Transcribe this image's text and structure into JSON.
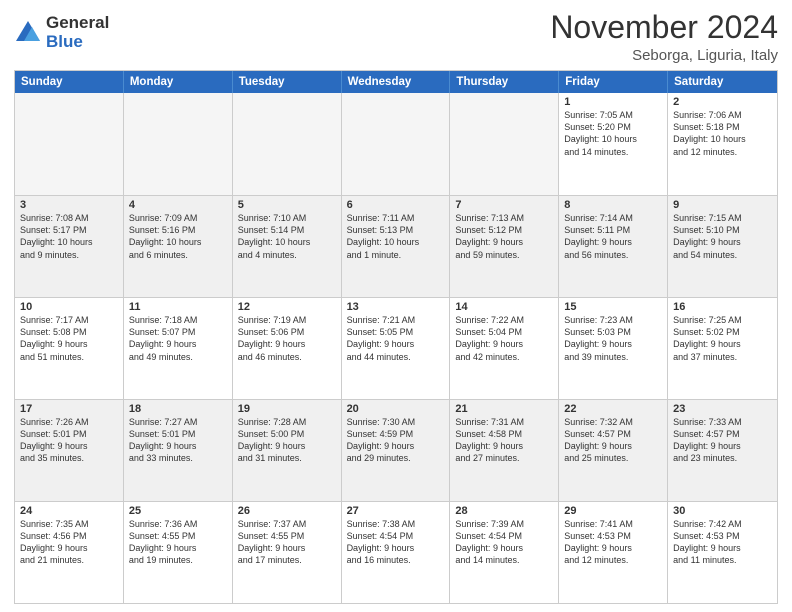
{
  "logo": {
    "general": "General",
    "blue": "Blue"
  },
  "header": {
    "month": "November 2024",
    "location": "Seborga, Liguria, Italy"
  },
  "weekdays": [
    "Sunday",
    "Monday",
    "Tuesday",
    "Wednesday",
    "Thursday",
    "Friday",
    "Saturday"
  ],
  "rows": [
    [
      {
        "day": "",
        "info": ""
      },
      {
        "day": "",
        "info": ""
      },
      {
        "day": "",
        "info": ""
      },
      {
        "day": "",
        "info": ""
      },
      {
        "day": "",
        "info": ""
      },
      {
        "day": "1",
        "info": "Sunrise: 7:05 AM\nSunset: 5:20 PM\nDaylight: 10 hours\nand 14 minutes."
      },
      {
        "day": "2",
        "info": "Sunrise: 7:06 AM\nSunset: 5:18 PM\nDaylight: 10 hours\nand 12 minutes."
      }
    ],
    [
      {
        "day": "3",
        "info": "Sunrise: 7:08 AM\nSunset: 5:17 PM\nDaylight: 10 hours\nand 9 minutes."
      },
      {
        "day": "4",
        "info": "Sunrise: 7:09 AM\nSunset: 5:16 PM\nDaylight: 10 hours\nand 6 minutes."
      },
      {
        "day": "5",
        "info": "Sunrise: 7:10 AM\nSunset: 5:14 PM\nDaylight: 10 hours\nand 4 minutes."
      },
      {
        "day": "6",
        "info": "Sunrise: 7:11 AM\nSunset: 5:13 PM\nDaylight: 10 hours\nand 1 minute."
      },
      {
        "day": "7",
        "info": "Sunrise: 7:13 AM\nSunset: 5:12 PM\nDaylight: 9 hours\nand 59 minutes."
      },
      {
        "day": "8",
        "info": "Sunrise: 7:14 AM\nSunset: 5:11 PM\nDaylight: 9 hours\nand 56 minutes."
      },
      {
        "day": "9",
        "info": "Sunrise: 7:15 AM\nSunset: 5:10 PM\nDaylight: 9 hours\nand 54 minutes."
      }
    ],
    [
      {
        "day": "10",
        "info": "Sunrise: 7:17 AM\nSunset: 5:08 PM\nDaylight: 9 hours\nand 51 minutes."
      },
      {
        "day": "11",
        "info": "Sunrise: 7:18 AM\nSunset: 5:07 PM\nDaylight: 9 hours\nand 49 minutes."
      },
      {
        "day": "12",
        "info": "Sunrise: 7:19 AM\nSunset: 5:06 PM\nDaylight: 9 hours\nand 46 minutes."
      },
      {
        "day": "13",
        "info": "Sunrise: 7:21 AM\nSunset: 5:05 PM\nDaylight: 9 hours\nand 44 minutes."
      },
      {
        "day": "14",
        "info": "Sunrise: 7:22 AM\nSunset: 5:04 PM\nDaylight: 9 hours\nand 42 minutes."
      },
      {
        "day": "15",
        "info": "Sunrise: 7:23 AM\nSunset: 5:03 PM\nDaylight: 9 hours\nand 39 minutes."
      },
      {
        "day": "16",
        "info": "Sunrise: 7:25 AM\nSunset: 5:02 PM\nDaylight: 9 hours\nand 37 minutes."
      }
    ],
    [
      {
        "day": "17",
        "info": "Sunrise: 7:26 AM\nSunset: 5:01 PM\nDaylight: 9 hours\nand 35 minutes."
      },
      {
        "day": "18",
        "info": "Sunrise: 7:27 AM\nSunset: 5:01 PM\nDaylight: 9 hours\nand 33 minutes."
      },
      {
        "day": "19",
        "info": "Sunrise: 7:28 AM\nSunset: 5:00 PM\nDaylight: 9 hours\nand 31 minutes."
      },
      {
        "day": "20",
        "info": "Sunrise: 7:30 AM\nSunset: 4:59 PM\nDaylight: 9 hours\nand 29 minutes."
      },
      {
        "day": "21",
        "info": "Sunrise: 7:31 AM\nSunset: 4:58 PM\nDaylight: 9 hours\nand 27 minutes."
      },
      {
        "day": "22",
        "info": "Sunrise: 7:32 AM\nSunset: 4:57 PM\nDaylight: 9 hours\nand 25 minutes."
      },
      {
        "day": "23",
        "info": "Sunrise: 7:33 AM\nSunset: 4:57 PM\nDaylight: 9 hours\nand 23 minutes."
      }
    ],
    [
      {
        "day": "24",
        "info": "Sunrise: 7:35 AM\nSunset: 4:56 PM\nDaylight: 9 hours\nand 21 minutes."
      },
      {
        "day": "25",
        "info": "Sunrise: 7:36 AM\nSunset: 4:55 PM\nDaylight: 9 hours\nand 19 minutes."
      },
      {
        "day": "26",
        "info": "Sunrise: 7:37 AM\nSunset: 4:55 PM\nDaylight: 9 hours\nand 17 minutes."
      },
      {
        "day": "27",
        "info": "Sunrise: 7:38 AM\nSunset: 4:54 PM\nDaylight: 9 hours\nand 16 minutes."
      },
      {
        "day": "28",
        "info": "Sunrise: 7:39 AM\nSunset: 4:54 PM\nDaylight: 9 hours\nand 14 minutes."
      },
      {
        "day": "29",
        "info": "Sunrise: 7:41 AM\nSunset: 4:53 PM\nDaylight: 9 hours\nand 12 minutes."
      },
      {
        "day": "30",
        "info": "Sunrise: 7:42 AM\nSunset: 4:53 PM\nDaylight: 9 hours\nand 11 minutes."
      }
    ]
  ]
}
